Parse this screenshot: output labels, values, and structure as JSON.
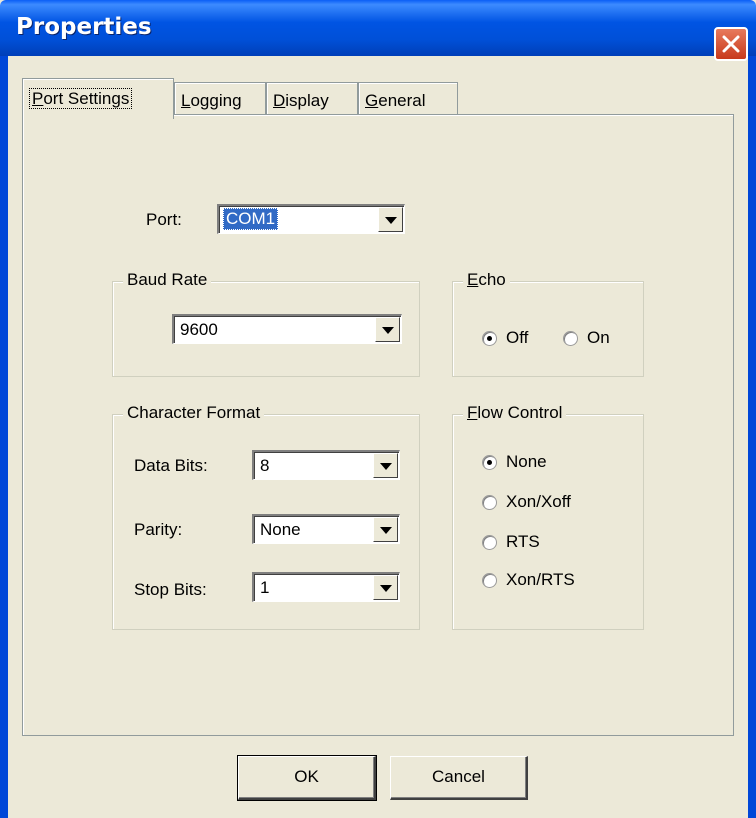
{
  "window": {
    "title": "Properties"
  },
  "tabs": [
    {
      "label_u": "P",
      "label_rest": "ort Settings"
    },
    {
      "label_u": "L",
      "label_rest": "ogging"
    },
    {
      "label_u": "D",
      "label_rest": "isplay"
    },
    {
      "label_u": "G",
      "label_rest": "eneral"
    }
  ],
  "port": {
    "label": "Port:",
    "value": "COM1"
  },
  "baud_rate": {
    "title": "Baud Rate",
    "value": "9600"
  },
  "echo": {
    "title_u": "E",
    "title_rest": "cho",
    "options": [
      "Off",
      "On"
    ],
    "selected": "Off"
  },
  "character_format": {
    "title": "Character Format",
    "data_bits_label": "Data Bits:",
    "data_bits_value": "8",
    "parity_label": "Parity:",
    "parity_value": "None",
    "stop_bits_label": "Stop Bits:",
    "stop_bits_value": "1"
  },
  "flow_control": {
    "title_u": "F",
    "title_rest": "low Control",
    "options": [
      "None",
      "Xon/Xoff",
      "RTS",
      "Xon/RTS"
    ],
    "selected": "None"
  },
  "buttons": {
    "ok": "OK",
    "cancel": "Cancel"
  },
  "icons": {
    "close": "close-icon",
    "dropdown": "chevron-down-icon"
  },
  "colors": {
    "titlebar": "#0054e3",
    "dialog_bg": "#ece9d8",
    "selection": "#316ac5",
    "close_button": "#d4502d"
  }
}
